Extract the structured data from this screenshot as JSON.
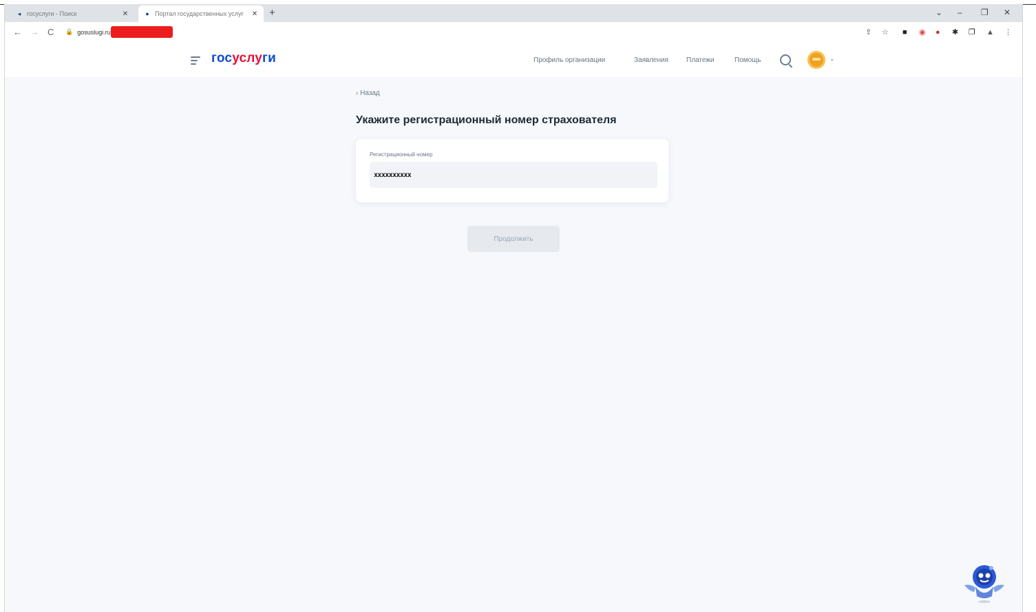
{
  "browser": {
    "tabs": [
      {
        "title": "госуслуги - Поиск",
        "favicon": "search-engine-icon",
        "close": "✕"
      },
      {
        "title": "Портал государственных услуг",
        "favicon": "gosuslugi-favicon",
        "close": "✕"
      }
    ],
    "new_tab": "+",
    "window_controls": {
      "dropdown": "⌄",
      "minimize": "–",
      "restore": "❐",
      "close": "✕"
    },
    "nav": {
      "back": "←",
      "forward": "→",
      "reload": "C"
    },
    "address": {
      "lock": "🔒",
      "url": "gosuslugi.ru"
    },
    "extensions": [
      "⇪",
      "☆",
      "■",
      "◉",
      "●",
      "✱",
      "❐",
      "▲",
      "⋮"
    ]
  },
  "header": {
    "logo_part1": "гос",
    "logo_part2": "услу",
    "logo_part3": "ги",
    "nav": [
      "Профиль организации",
      "Заявления",
      "Платежи",
      "Помощь"
    ],
    "avatar_chevron": "⌄"
  },
  "main": {
    "back": "‹ Назад",
    "title": "Укажите регистрационный номер страхователя",
    "field_label": "Регистрационный номер",
    "field_value": "xxxxxxxxxx",
    "continue": "Продолжить"
  },
  "colors": {
    "brand_blue": "#0d4cd3",
    "brand_red": "#e4133a",
    "page_bg": "#f6f8fb",
    "redaction": "#ec1d1d"
  }
}
